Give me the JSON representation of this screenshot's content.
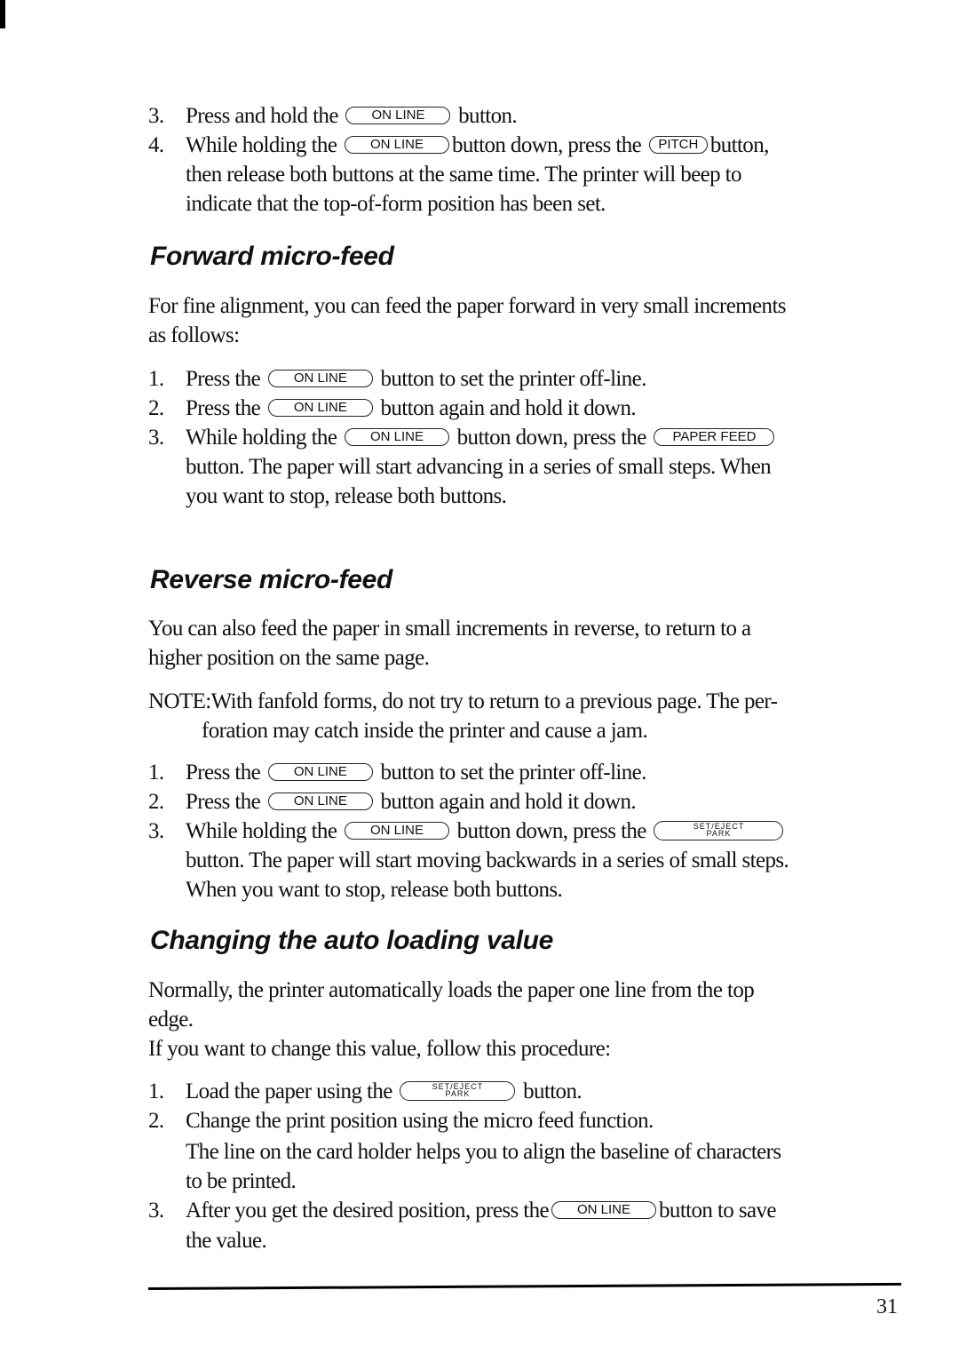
{
  "buttons": {
    "on_line": "ON LINE",
    "pitch": "PITCH",
    "paper_feed": "PAPER FEED",
    "set_eject_top": "SET/EJECT",
    "set_eject_bottom": "PARK"
  },
  "intro_steps": [
    {
      "num": "3.",
      "before": "Press and hold the",
      "after": "button."
    },
    {
      "num": "4.",
      "before": "While holding the",
      "middle": "button down, press the",
      "after": "button,",
      "cont1": "then release both buttons at the same time. The printer will beep to",
      "cont2": "indicate that the top-of-form position has been set."
    }
  ],
  "forward": {
    "heading": "Forward micro-feed",
    "intro_line1": "For fine alignment, you can feed the paper forward in very small increments",
    "intro_line2": "as follows:",
    "steps": [
      {
        "num": "1.",
        "before": "Press the",
        "after": "button to set the printer off-line."
      },
      {
        "num": "2.",
        "before": "Press the",
        "after": "button again and hold it down."
      },
      {
        "num": "3.",
        "before": "While holding the",
        "middle": "button down, press the",
        "cont1": "button. The paper will start advancing in a series of small steps. When",
        "cont2": "you want to stop, release both buttons."
      }
    ]
  },
  "reverse": {
    "heading": "Reverse micro-feed",
    "intro_line1": "You can also feed the paper in small increments in reverse, to return to a",
    "intro_line2": "higher position on the same page.",
    "note_label": "NOTE:",
    "note_line1": "With fanfold forms, do not try to return to a previous page. The per-",
    "note_line2": "foration may catch inside the printer and cause a jam.",
    "steps": [
      {
        "num": "1.",
        "before": "Press the",
        "after": "button to set the printer off-line."
      },
      {
        "num": "2.",
        "before": "Press the",
        "after": "button again and hold it down."
      },
      {
        "num": "3.",
        "before": "While holding the",
        "middle": "button down, press the",
        "cont1": "button. The paper will start moving backwards in a series of small steps.",
        "cont2": "When you want to stop, release both buttons."
      }
    ]
  },
  "auto_loading": {
    "heading": "Changing the auto loading value",
    "intro_line1": "Normally, the printer automatically loads the paper one line from the top",
    "intro_line2": "edge.",
    "intro_line3": "If you want to change this value, follow this procedure:",
    "steps": [
      {
        "num": "1.",
        "before": "Load the paper using the",
        "after": "button."
      },
      {
        "num": "2.",
        "text": "Change the print position using the micro feed function.",
        "cont1": "The line on the card holder helps you to align the baseline of characters",
        "cont2": "to be printed."
      },
      {
        "num": "3.",
        "before": "After you get the desired position, press the",
        "after": "button to save",
        "cont1": "the value."
      }
    ]
  },
  "page_number": "31"
}
